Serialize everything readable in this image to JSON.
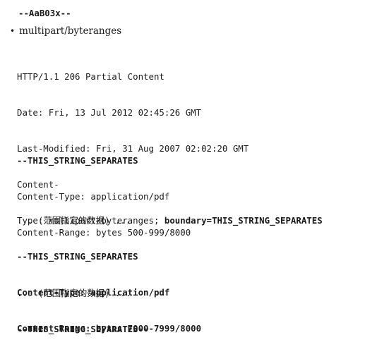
{
  "top_boundary": "--AaB03x--",
  "bullet_item": "multipart/byteranges",
  "headers": {
    "line1": "HTTP/1.1 206 Partial Content",
    "line2": "Date: Fri, 13 Jul 2012 02:45:26 GMT",
    "line3": "Last-Modified: Fri, 31 Aug 2007 02:02:20 GMT",
    "line4": "Content-",
    "line5_prefix": "Type: multipart/byteranges; ",
    "line5_bold": "boundary=THIS_STRING_SEPARATES"
  },
  "part1": {
    "boundary": "--THIS_STRING_SEPARATES",
    "content_type": "Content-Type: application/pdf",
    "content_range": "Content-Range: bytes 500-999/8000"
  },
  "part2": {
    "ellipsis": "... (范围指定的数据) ...",
    "boundary": "--THIS_STRING_SEPARATES",
    "content_type": "Content-Type: application/pdf",
    "content_range": "Content-Range: bytes 7000-7999/8000"
  },
  "end": {
    "ellipsis": "... (范围指定的数据) ...",
    "boundary": "--THIS_STRING_SEPARATES--"
  }
}
